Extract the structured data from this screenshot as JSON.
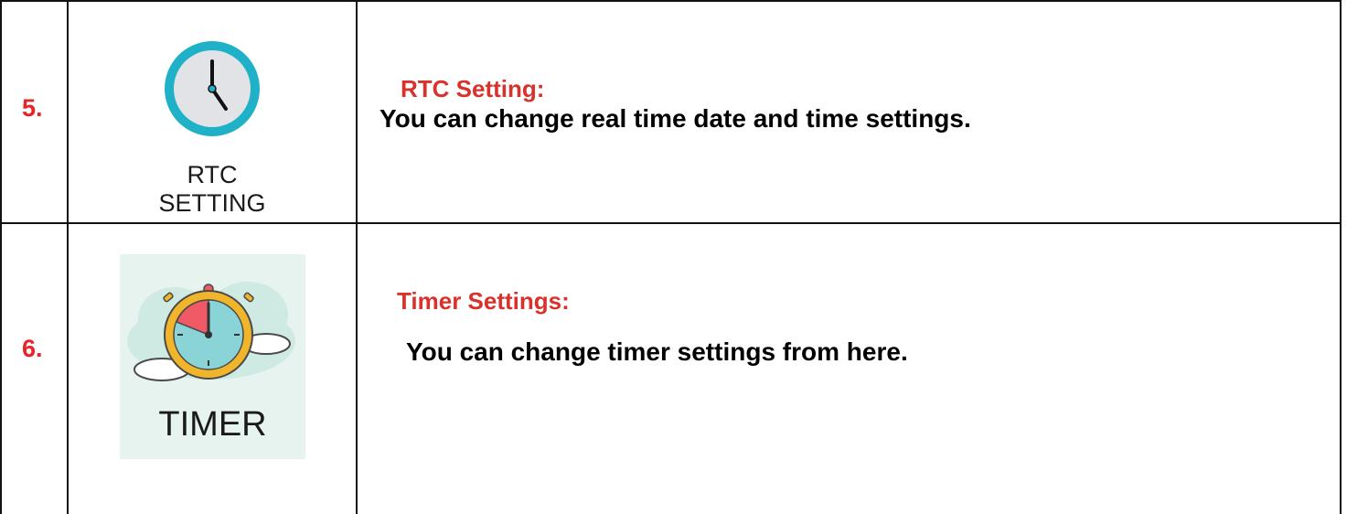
{
  "rows": [
    {
      "number": "5.",
      "icon_name": "clock-icon",
      "icon_label_lines": [
        "RTC",
        "SETTING"
      ],
      "heading": "RTC Setting:",
      "description": "You can change real time date and time settings."
    },
    {
      "number": "6.",
      "icon_name": "timer-stopwatch-icon",
      "icon_label": "TIMER",
      "heading": "Timer Settings:",
      "description": "You can change timer settings from here."
    }
  ],
  "colors": {
    "number_red": "#e8242b",
    "heading_red": "#d9312b",
    "clock_ring": "#1fb1c8",
    "timer_gold": "#f0b52a",
    "timer_face": "#8ad3d6",
    "timer_wedge": "#f05a67"
  }
}
